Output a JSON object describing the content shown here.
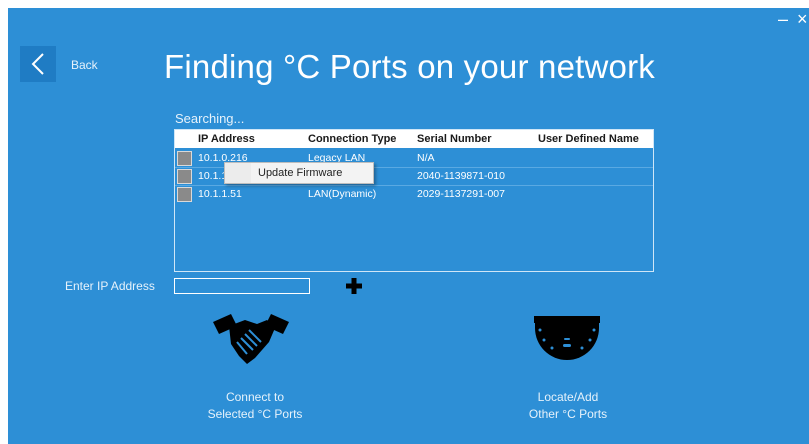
{
  "window": {
    "minimize_glyph": "–",
    "close_glyph": "×"
  },
  "nav": {
    "back_label": "Back"
  },
  "page": {
    "title": "Finding °C Ports on your network",
    "status": "Searching..."
  },
  "grid": {
    "columns": [
      "IP Address",
      "Connection Type",
      "Serial Number",
      "User Defined Name"
    ],
    "rows": [
      {
        "ip": "10.1.0.216",
        "connection": "Legacy LAN",
        "serial": "N/A",
        "name": ""
      },
      {
        "ip": "10.1.1",
        "connection": "",
        "serial": "2040-1139871-010",
        "name": ""
      },
      {
        "ip": "10.1.1.51",
        "connection": "LAN(Dynamic)",
        "serial": "2029-1137291-007",
        "name": ""
      }
    ]
  },
  "context_menu": {
    "item": "Update Firmware"
  },
  "ip_entry": {
    "label": "Enter IP Address",
    "value": ""
  },
  "actions": {
    "connect": {
      "line1": "Connect to",
      "line2": "Selected °C Ports",
      "icon": "handshake-icon"
    },
    "locate": {
      "line1": "Locate/Add",
      "line2": "Other °C Ports",
      "icon": "port-device-icon"
    }
  },
  "colors": {
    "background": "#2d8fd6",
    "header": "#ffffff",
    "text": "#ffffff"
  }
}
